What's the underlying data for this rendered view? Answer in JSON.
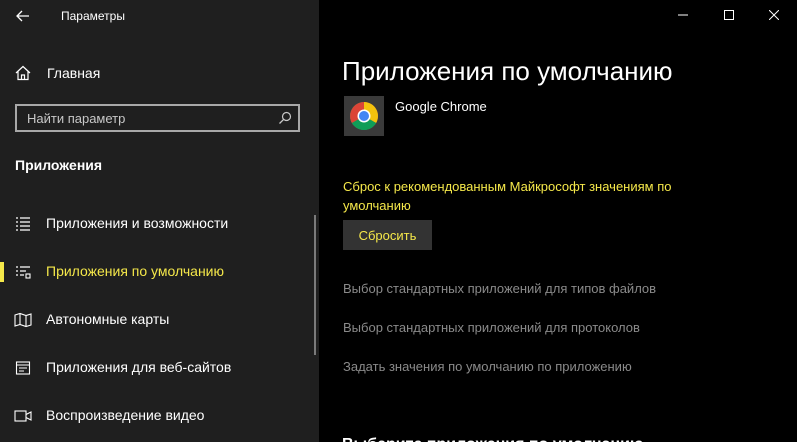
{
  "window": {
    "title": "Параметры",
    "controls": [
      "minimize-icon",
      "maximize-icon",
      "close-icon"
    ]
  },
  "sidebar": {
    "home_label": "Главная",
    "search_placeholder": "Найти параметр",
    "section_title": "Приложения",
    "items": [
      {
        "label": "Приложения и возможности",
        "icon": "apps-list-icon",
        "active": false
      },
      {
        "label": "Приложения по умолчанию",
        "icon": "default-apps-icon",
        "active": true
      },
      {
        "label": "Автономные карты",
        "icon": "map-icon",
        "active": false
      },
      {
        "label": "Приложения для веб-сайтов",
        "icon": "web-apps-icon",
        "active": false
      },
      {
        "label": "Воспроизведение видео",
        "icon": "video-icon",
        "active": false
      }
    ]
  },
  "main": {
    "title": "Приложения по умолчанию",
    "default_app": {
      "name": "Google Chrome",
      "icon": "chrome-icon"
    },
    "reset_description": "Сброс к рекомендованным Майкрософт значениям по умолчанию",
    "reset_button": "Сбросить",
    "links": [
      "Выбор стандартных приложений для типов файлов",
      "Выбор стандартных приложений для протоколов",
      "Задать значения по умолчанию по приложению"
    ],
    "cut_heading": "Выберите приложения по умолчанию"
  },
  "colors": {
    "accent": "#f5e84a",
    "sidebar_bg": "#1f1f1f",
    "main_bg": "#000000",
    "link_gray": "#8a8a8a"
  }
}
